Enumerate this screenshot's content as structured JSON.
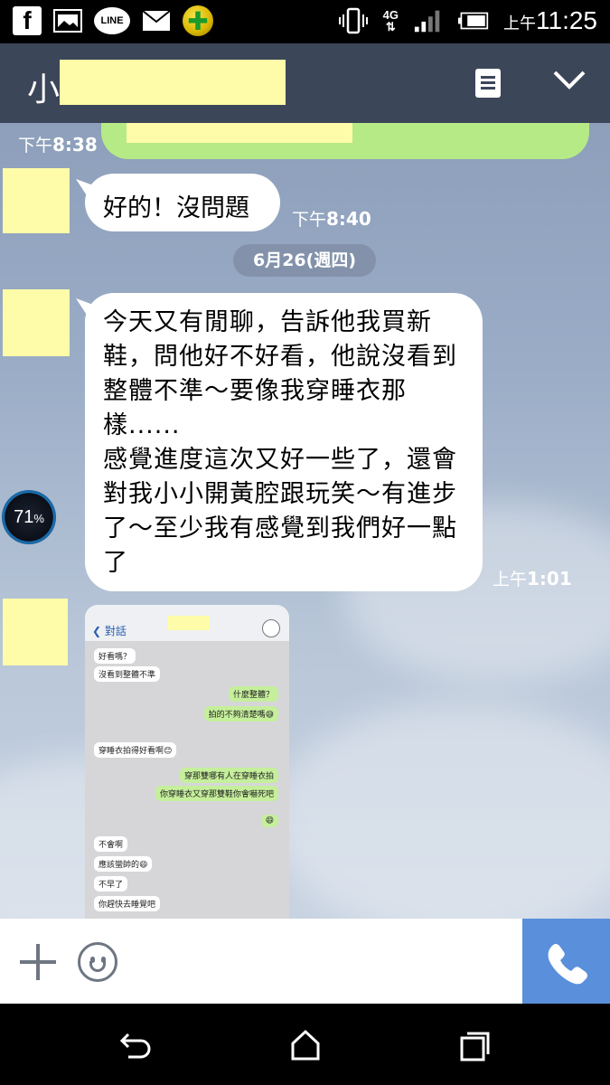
{
  "status_bar": {
    "time_prefix": "上午",
    "time": "11:25",
    "network": "4G",
    "notification_icons": [
      "facebook-icon",
      "gallery-icon",
      "line-icon",
      "mail-icon",
      "green-plus-icon"
    ],
    "line_label": "LINE"
  },
  "header": {
    "title_prefix": "小",
    "title_redacted": true
  },
  "messages": {
    "m0_time_prefix": "下午",
    "m0_time": "8:38",
    "m1_text": "好的！沒問題",
    "m1_time_prefix": "下午",
    "m1_time": "8:40",
    "date_separator": "6月26(週四)",
    "m2_text": "今天又有閒聊，告訴他我買新鞋，問他好不好看，他說沒看到整體不準～要像我穿睡衣那樣......\n感覺進度這次又好一些了，還會對我小小開黃腔跟玩笑～有進步了～至少我有感覺到我們好一點了",
    "m2_time_prefix": "上午",
    "m2_time": "1:01"
  },
  "overlay": {
    "battery_percent": "71",
    "battery_unit": "%"
  },
  "screenshot": {
    "back_label": "對話",
    "lines": [
      {
        "side": "l",
        "text": "好看嗎？"
      },
      {
        "side": "l",
        "text": "沒看到整體不準"
      },
      {
        "side": "r",
        "text": "什麼整體？"
      },
      {
        "side": "r",
        "text": "拍的不夠清楚嗎😅"
      },
      {
        "side": "l",
        "text": "穿睡衣拍得好看啊😊"
      },
      {
        "side": "r",
        "text": "穿那雙哪有人在穿睡衣拍"
      },
      {
        "side": "r",
        "text": "你穿睡衣又穿那雙鞋你會嚇死吧"
      },
      {
        "side": "r",
        "text": "😄"
      },
      {
        "side": "l",
        "text": "不會啊"
      },
      {
        "side": "l",
        "text": "應該蠻帥的😄"
      },
      {
        "side": "l",
        "text": "不早了"
      },
      {
        "side": "l",
        "text": "你趕快去睡覺吧"
      }
    ]
  }
}
